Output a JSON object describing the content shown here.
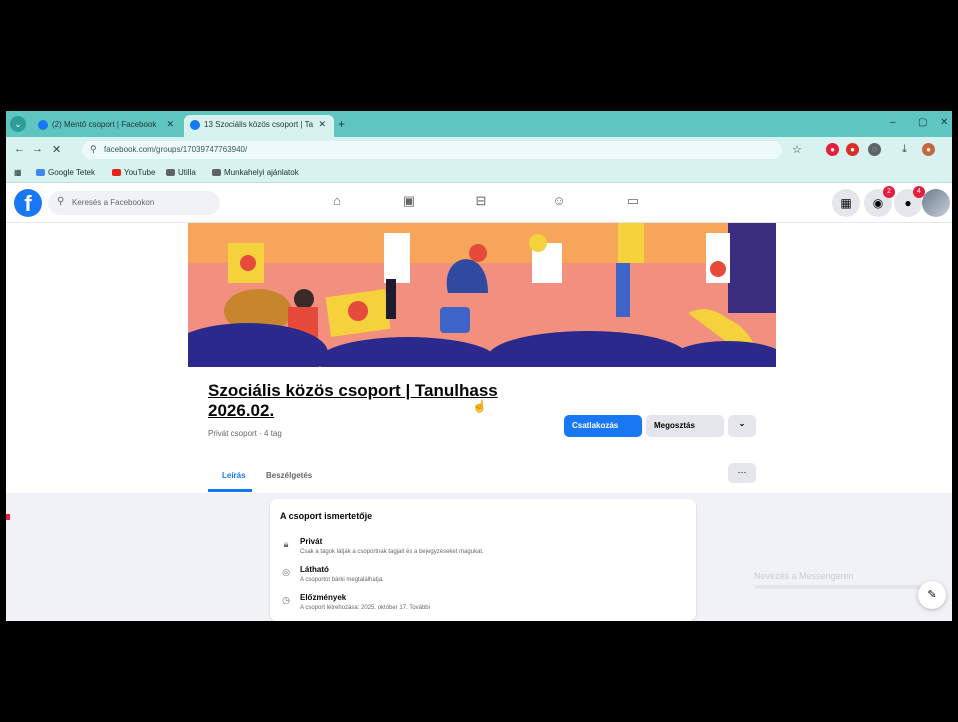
{
  "browser": {
    "tabs": [
      {
        "label": "(2) Mentő csoport | Facebook"
      },
      {
        "label": "13 Szociális közös csoport | Ta"
      }
    ],
    "url": "facebook.com/groups/17039747763940/",
    "bookmarks": [
      {
        "label": "Google Tetek",
        "color": "#4285f4"
      },
      {
        "label": "YouTube",
        "color": "#e62117"
      },
      {
        "label": "Utilla",
        "color": "#5f6368"
      },
      {
        "label": "Munkahelyi ajánlatok",
        "color": "#5f6368"
      }
    ]
  },
  "facebook": {
    "logo": "f",
    "search_placeholder": "Keresés a Facebookon",
    "notifications": {
      "messages_badge": "2",
      "alerts_badge": "4"
    }
  },
  "group": {
    "title": "Szociális közös csoport | Tanulhass 2026.02.",
    "meta": "Privát csoport · 4 tag",
    "join_label": "Csatlakozás",
    "share_label": "Megosztás",
    "more_label": "⌄",
    "tabs": [
      {
        "label": "Leírás",
        "active": true
      },
      {
        "label": "Beszélgetés",
        "active": false
      }
    ]
  },
  "about": {
    "title": "A csoport ismertetője",
    "items": [
      {
        "icon": "lock-icon",
        "heading": "Privát",
        "desc": "Csak a tagok látják a csoportnak tagjait és a bejegyzéseket magukat."
      },
      {
        "icon": "eye-icon",
        "heading": "Látható",
        "desc": "A csoportot bárki megtalálhatja."
      },
      {
        "icon": "clock-icon",
        "heading": "Előzmények",
        "desc": "A csoport létrehozása: 2025. október 17. További"
      }
    ]
  },
  "right_panel": {
    "text": "Nevezés a Messengeren"
  },
  "colors": {
    "brand": "#1877f2",
    "tab_strip": "#5fc5c0",
    "addressbar": "#d8f2f0"
  }
}
